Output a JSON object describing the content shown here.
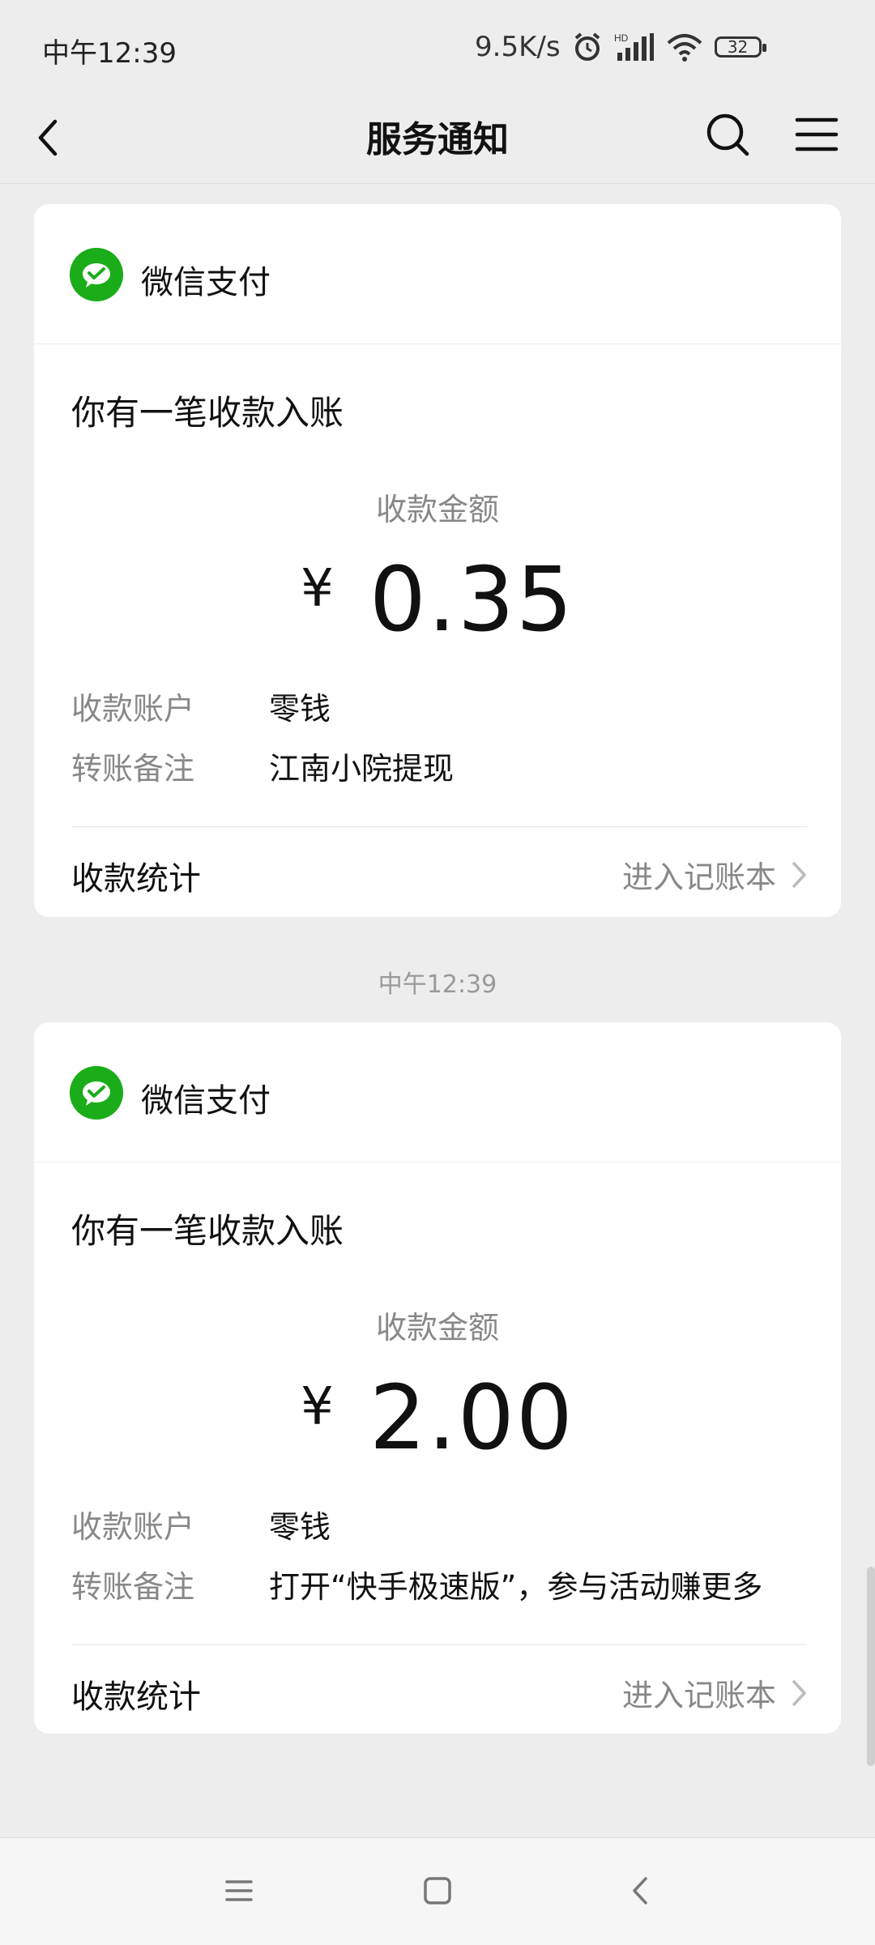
{
  "status_bar": {
    "time": "中午12:39",
    "network_speed": "9.5K/s",
    "battery": "32",
    "icons": [
      "alarm-icon",
      "hd-signal-icon",
      "wifi-icon",
      "battery-icon"
    ]
  },
  "nav": {
    "title": "服务通知",
    "icons": [
      "back-icon",
      "search-icon",
      "menu-icon"
    ]
  },
  "cards": [
    {
      "brand": "微信支付",
      "title": "你有一笔收款入账",
      "amount_label": "收款金额",
      "currency": "¥",
      "amount": "0.35",
      "fields": [
        {
          "key": "收款账户",
          "value": "零钱"
        },
        {
          "key": "转账备注",
          "value": "江南小院提现"
        }
      ],
      "stats_label": "收款统计",
      "stats_link": "进入记账本"
    },
    {
      "brand": "微信支付",
      "title": "你有一笔收款入账",
      "amount_label": "收款金额",
      "currency": "¥",
      "amount": "2.00",
      "fields": [
        {
          "key": "收款账户",
          "value": "零钱"
        },
        {
          "key": "转账备注",
          "value": "打开“快手极速版”，参与活动赚更多"
        }
      ],
      "stats_label": "收款统计",
      "stats_link": "进入记账本"
    }
  ],
  "time_separator": "中午12:39",
  "colors": {
    "background": "#ededed",
    "card": "#ffffff",
    "wechat_pay_green": "#1aad19",
    "muted_text": "#888888"
  },
  "bottom_nav_icons": [
    "recent-apps-icon",
    "home-icon",
    "back-nav-icon"
  ]
}
